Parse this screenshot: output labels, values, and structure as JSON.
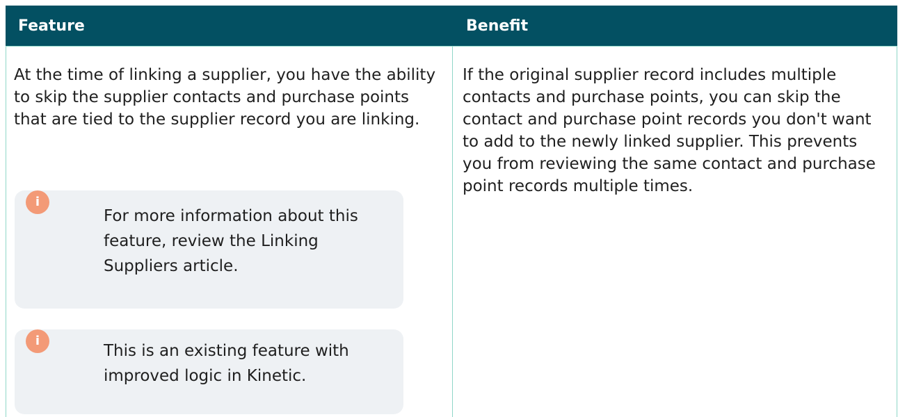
{
  "table": {
    "headers": {
      "feature": "Feature",
      "benefit": "Benefit"
    },
    "row": {
      "feature_text": "At the time of linking a supplier, you have the ability to skip the supplier contacts and purchase points that are tied to the supplier record you are linking.",
      "notes": [
        {
          "icon": "info-icon",
          "text": "For more information about this feature, review the Linking Suppliers article."
        },
        {
          "icon": "info-icon",
          "text": "This is an existing feature with improved logic in Kinetic."
        }
      ],
      "benefit_text": "If the original supplier record includes multiple contacts and purchase points, you can skip the contact and purchase point records you don't want to add to the newly linked supplier. This prevents you from reviewing the same contact and purchase point records multiple times."
    }
  },
  "colors": {
    "header_background": "#035062",
    "header_text": "#ffffff",
    "cell_border": "#8fd7c8",
    "note_background": "#eef1f4",
    "info_icon": "#f39a77"
  }
}
